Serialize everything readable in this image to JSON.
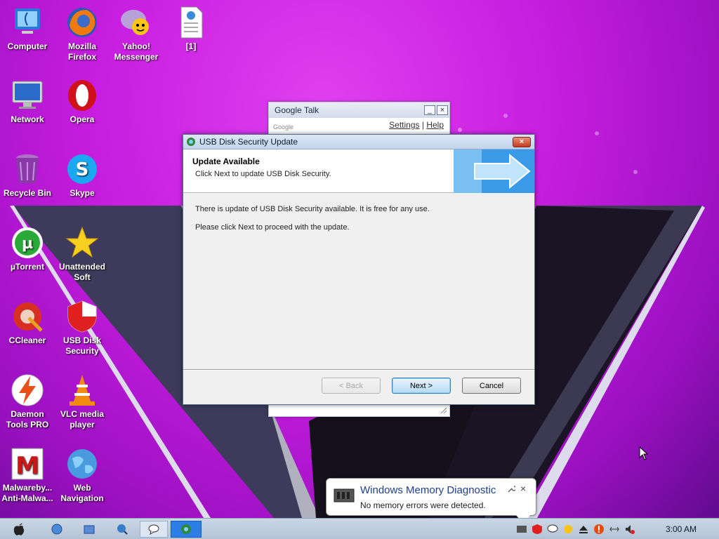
{
  "desktop": {
    "icons": [
      {
        "label": "Computer"
      },
      {
        "label": "Mozilla Firefox"
      },
      {
        "label": "Yahoo! Messenger"
      },
      {
        "label": "[1]"
      },
      {
        "label": "Network"
      },
      {
        "label": "Opera"
      },
      {
        "label": "Recycle Bin"
      },
      {
        "label": "Skype"
      },
      {
        "label": "µTorrent"
      },
      {
        "label": "Unattended Soft"
      },
      {
        "label": "CCleaner"
      },
      {
        "label": "USB Disk Security"
      },
      {
        "label": "Daemon Tools PRO"
      },
      {
        "label": "VLC media player"
      },
      {
        "label": "Malwareby... Anti-Malwa..."
      },
      {
        "label": "Web Navigation"
      }
    ]
  },
  "gtalk": {
    "title": "Google Talk",
    "minimize": "_",
    "close": "×",
    "settings": "Settings",
    "separator": "|",
    "help": "Help",
    "logo": "Google"
  },
  "dialog": {
    "title": "USB Disk Security Update",
    "close": "×",
    "heading": "Update Available",
    "subheading": "Click Next to update USB Disk Security.",
    "line1": "There is update of USB Disk Security available. It is free for any use.",
    "line2": "Please click Next to proceed with the update.",
    "back_label": "< Back",
    "next_label": "Next >",
    "cancel_label": "Cancel"
  },
  "notification": {
    "title": "Windows Memory Diagnostic",
    "message": "No memory errors were detected.",
    "close": "×"
  },
  "taskbar": {
    "clock": "3:00 AM"
  },
  "colors": {
    "accent": "#2d7fe6",
    "background": "#c81ee0"
  }
}
